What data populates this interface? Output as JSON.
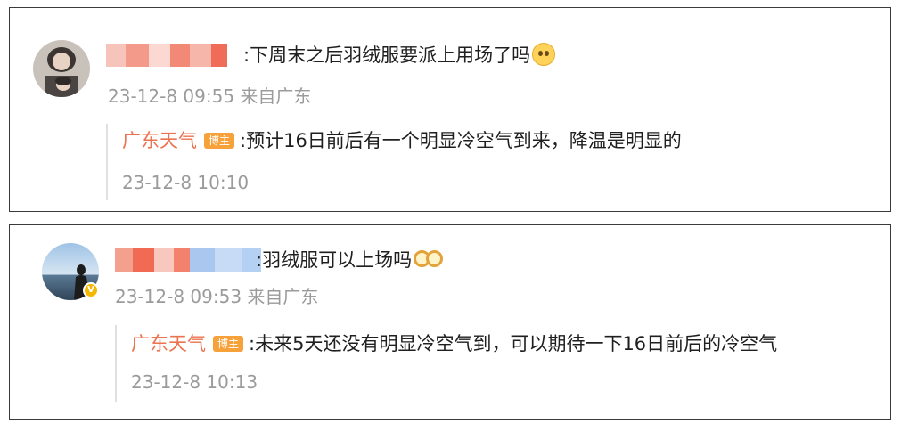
{
  "comments": [
    {
      "avatar_icon": "user-avatar-icon",
      "text": ":下周末之后羽绒服要派上用场了吗",
      "emoji_icon": "thinking-emoji-icon",
      "meta": "23-12-8 09:55 来自广东",
      "reply": {
        "author": "广东天气",
        "badge": "博主",
        "text": ":预计16日前后有一个明显冷空气到来，降温是明显的",
        "time": "23-12-8 10:10"
      }
    },
    {
      "avatar_icon": "user-avatar-icon",
      "verified_icon": "verified-badge-icon",
      "text": ":羽绒服可以上场吗",
      "emoji_icon": "glasses-emoji-icon",
      "meta": "23-12-8 09:53 来自广东",
      "reply": {
        "author": "广东天气",
        "badge": "博主",
        "text": ":未来5天还没有明显冷空气到，可以期待一下16日前后的冷空气",
        "time": "23-12-8 10:13"
      }
    }
  ],
  "colors": {
    "author": "#eb7350",
    "badge": "#f7a13b",
    "meta": "#9b9b9b",
    "verified": "#f5b800"
  }
}
